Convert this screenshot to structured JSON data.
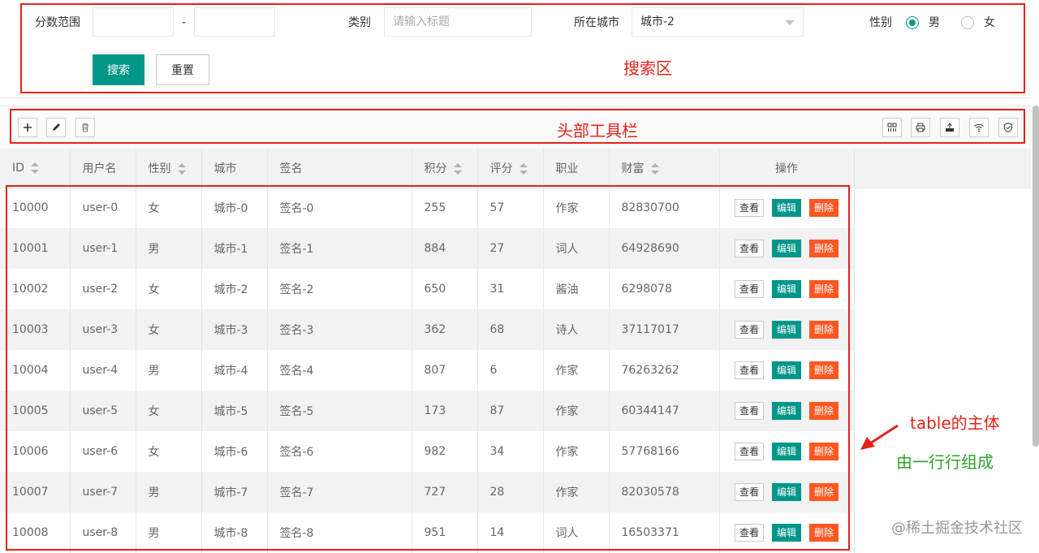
{
  "search": {
    "score_range_label": "分数范围",
    "range_dash": "-",
    "score_min": "",
    "score_max": "",
    "category_label": "类别",
    "category_placeholder": "请输入标题",
    "city_label": "所在城市",
    "city_value": "城市-2",
    "gender_label": "性别",
    "gender_options": [
      "男",
      "女"
    ],
    "gender_selected": "男",
    "search_button": "搜索",
    "reset_button": "重置"
  },
  "toolbar": {
    "left_icons": [
      "add-icon",
      "edit-icon",
      "delete-icon"
    ],
    "right_icons": [
      "columns-icon",
      "print-icon",
      "export-icon",
      "wifi-icon",
      "shield-icon"
    ]
  },
  "table": {
    "columns": [
      {
        "label": "ID",
        "sortable": true
      },
      {
        "label": "用户名",
        "sortable": false
      },
      {
        "label": "性别",
        "sortable": true
      },
      {
        "label": "城市",
        "sortable": false
      },
      {
        "label": "签名",
        "sortable": false
      },
      {
        "label": "积分",
        "sortable": true
      },
      {
        "label": "评分",
        "sortable": true
      },
      {
        "label": "职业",
        "sortable": false
      },
      {
        "label": "财富",
        "sortable": true
      },
      {
        "label": "操作",
        "sortable": false
      }
    ],
    "actions": {
      "view": "查看",
      "edit": "编辑",
      "delete": "删除"
    },
    "rows": [
      [
        "10000",
        "user-0",
        "女",
        "城市-0",
        "签名-0",
        "255",
        "57",
        "作家",
        "82830700"
      ],
      [
        "10001",
        "user-1",
        "男",
        "城市-1",
        "签名-1",
        "884",
        "27",
        "词人",
        "64928690"
      ],
      [
        "10002",
        "user-2",
        "女",
        "城市-2",
        "签名-2",
        "650",
        "31",
        "酱油",
        "6298078"
      ],
      [
        "10003",
        "user-3",
        "女",
        "城市-3",
        "签名-3",
        "362",
        "68",
        "诗人",
        "37117017"
      ],
      [
        "10004",
        "user-4",
        "男",
        "城市-4",
        "签名-4",
        "807",
        "6",
        "作家",
        "76263262"
      ],
      [
        "10005",
        "user-5",
        "女",
        "城市-5",
        "签名-5",
        "173",
        "87",
        "作家",
        "60344147"
      ],
      [
        "10006",
        "user-6",
        "女",
        "城市-6",
        "签名-6",
        "982",
        "34",
        "作家",
        "57768166"
      ],
      [
        "10007",
        "user-7",
        "男",
        "城市-7",
        "签名-7",
        "727",
        "28",
        "作家",
        "82030578"
      ],
      [
        "10008",
        "user-8",
        "男",
        "城市-8",
        "签名-8",
        "951",
        "14",
        "词人",
        "16503371"
      ]
    ]
  },
  "annotations": {
    "search_area": "搜索区",
    "header_toolbar": "头部工具栏",
    "table_body": "table的主体",
    "rows_compose": "由一行行组成"
  },
  "watermark": "@稀土掘金技术社区",
  "colors": {
    "primary": "#009688",
    "danger": "#ff5722",
    "annotation_red": "#e2231a",
    "annotation_green": "#2ea22e"
  }
}
